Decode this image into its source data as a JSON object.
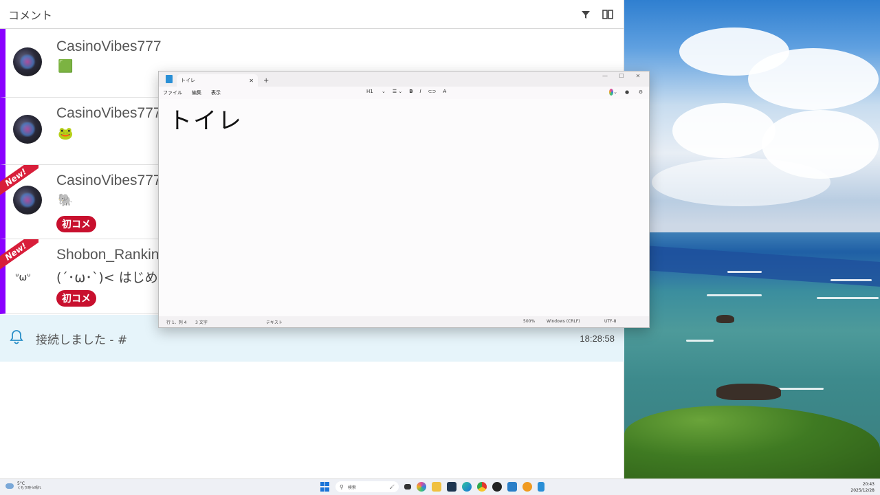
{
  "comment_panel": {
    "title": "コメント",
    "comments": [
      {
        "author": "CasinoVibes777",
        "emoji": "🟩",
        "is_new": false,
        "first_comment": false
      },
      {
        "author": "CasinoVibes777",
        "emoji": "🐸",
        "is_new": false,
        "first_comment": false
      },
      {
        "author": "CasinoVibes777",
        "emoji": "🐘",
        "is_new": true,
        "first_comment": true
      },
      {
        "author": "Shobon_Rankin",
        "avatar_text": "ᐡωᐡ",
        "message": "(´･ω･`)< はじめ",
        "is_new": true,
        "first_comment": true
      }
    ],
    "new_label": "New!",
    "first_comment_label": "初コメ",
    "notice": {
      "text": "接続しました - #",
      "time": "18:28:58"
    }
  },
  "notepad": {
    "tab_title": "トイレ",
    "menu": [
      "ファイル",
      "編集",
      "表示"
    ],
    "format": {
      "heading": "H1",
      "bold": "B",
      "italic": "I"
    },
    "content_heading": "トイレ",
    "status": {
      "position": "行 1、列 4",
      "chars": "3 文字",
      "mode": "テキスト",
      "zoom": "500%",
      "line_ending": "Windows (CRLF)",
      "encoding": "UTF-8"
    }
  },
  "taskbar": {
    "weather_temp": "5°C",
    "weather_cond": "くもり時々晴れ",
    "search_placeholder": "検索",
    "time": "20:43",
    "date": "2025/12/28"
  }
}
